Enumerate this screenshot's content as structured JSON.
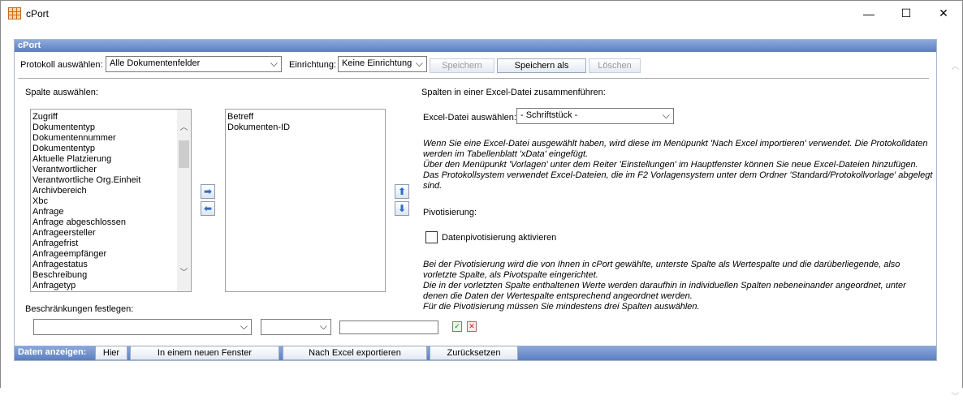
{
  "window": {
    "title": "cPort",
    "minimize": "—",
    "maximize": "☐",
    "close": "✕"
  },
  "panel": {
    "header": "cPort"
  },
  "toolbar": {
    "protokoll_label": "Protokoll auswählen:",
    "protokoll_value": "Alle Dokumentenfelder",
    "einrichtung_label": "Einrichtung:",
    "einrichtung_value": "Keine Einrichtung",
    "speichern": "Speichern",
    "speichern_als": "Speichern als",
    "loeschen": "Löschen"
  },
  "columns": {
    "label": "Spalte auswählen:",
    "available": [
      "Zugriff",
      "Dokumententyp",
      "Dokumentennummer",
      "Dokumententyp",
      "Aktuelle Platzierung",
      "Verantwortlicher",
      "Verantwortliche Org.Einheit",
      "Archivbereich",
      "Xbc",
      "Anfrage",
      "Anfrage abgeschlossen",
      "Anfrageersteller",
      "Anfragefrist",
      "Anfrageempfänger",
      "Anfragestatus",
      "Beschreibung",
      "Anfragetyp"
    ],
    "selected": [
      "Betreff",
      "Dokumenten-ID"
    ]
  },
  "constraints": {
    "label": "Beschränkungen festlegen:"
  },
  "excel": {
    "title": "Spalten in einer Excel-Datei zusammenführen:",
    "file_label": "Excel-Datei auswählen:",
    "file_value": "- Schriftstück -",
    "info": [
      "Wenn Sie eine Excel-Datei ausgewählt haben, wird diese im Menüpunkt 'Nach Excel importieren' verwendet. Die Protokolldaten",
      "werden im Tabellenblatt 'xData' eingefügt.",
      "Über den Menüpunkt 'Vorlagen' unter dem Reiter 'Einstellungen' im Hauptfenster können Sie neue Excel-Dateien hinzufügen.",
      "Das Protokollsystem verwendet Excel-Dateien, die im F2 Vorlagensystem unter dem Ordner 'Standard/Protokollvorlage' abgelegt",
      "sind."
    ]
  },
  "pivot": {
    "title": "Pivotisierung:",
    "checkbox_label": "Datenpivotisierung aktivieren",
    "info": [
      "Bei der Pivotisierung wird die von Ihnen in cPort gewählte, unterste Spalte als Wertespalte und die darüberliegende, also",
      "vorletzte Spalte, als Pivotspalte eingerichtet.",
      "Die in der vorletzten Spalte enthaltenen Werte werden daraufhin in individuellen Spalten nebeneinander angeordnet, unter",
      "denen die Daten der Wertespalte entsprechend angeordnet werden.",
      "Für die Pivotisierung müssen Sie mindestens drei Spalten auswählen."
    ]
  },
  "bottom": {
    "label": "Daten anzeigen:",
    "hier": "Hier",
    "neues_fenster": "In einem neuen Fenster",
    "excel_export": "Nach Excel exportieren",
    "zuruecksetzen": "Zurücksetzen"
  }
}
